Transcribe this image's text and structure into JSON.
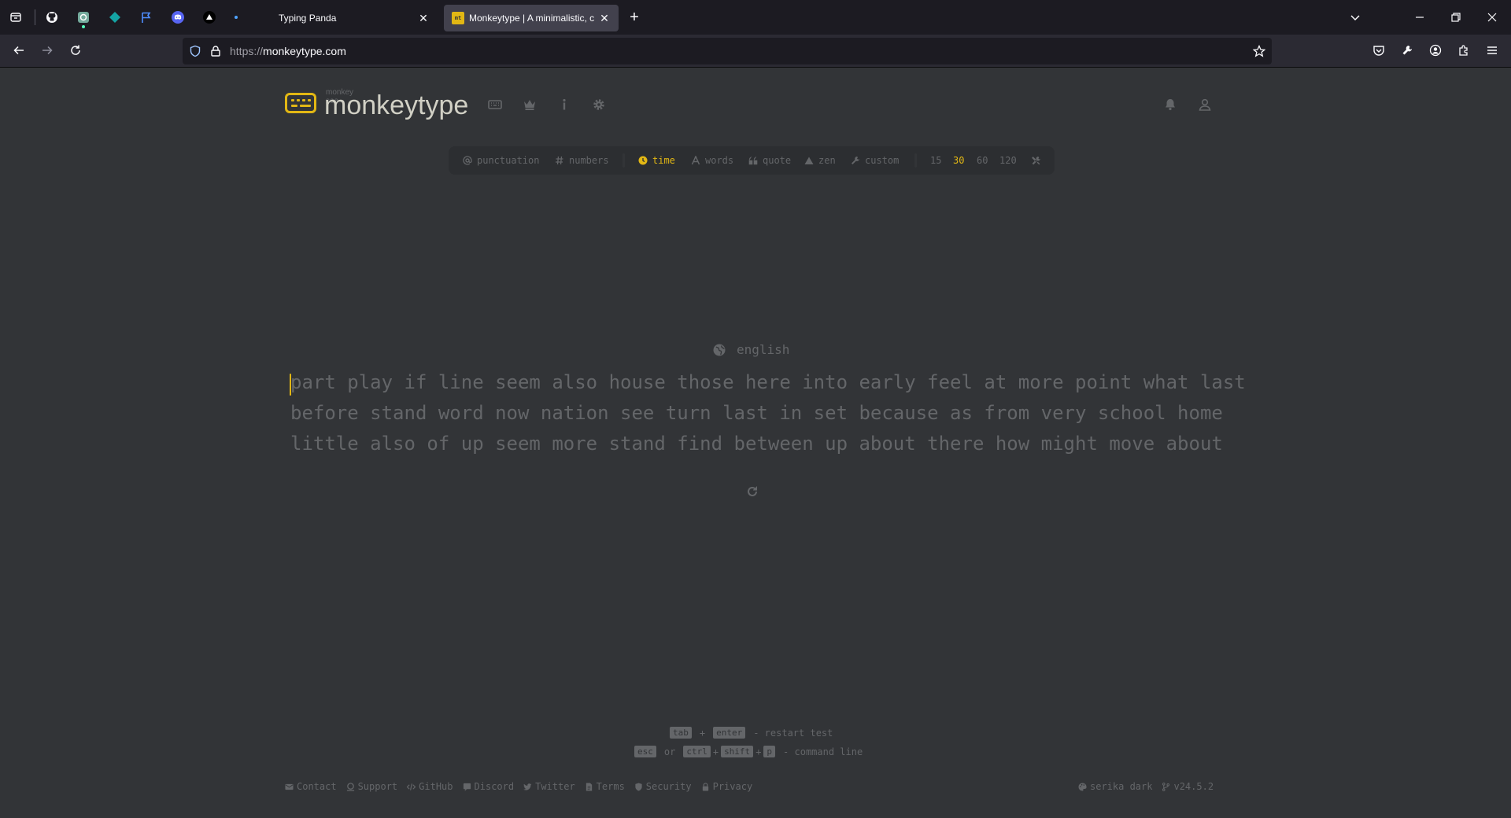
{
  "browser": {
    "tabs": [
      {
        "title": "Typing Panda",
        "active": false
      },
      {
        "title": "Monkeytype | A minimalistic, c",
        "active": true,
        "favicon": "mt"
      }
    ],
    "new_tab_label": "+",
    "url_scheme": "https://",
    "url_host": "monkeytype.com"
  },
  "logo": {
    "top_text": "monkey see",
    "main_text": "monkeytype"
  },
  "config": {
    "punctuation": "punctuation",
    "numbers": "numbers",
    "time": "time",
    "words": "words",
    "quote": "quote",
    "zen": "zen",
    "custom": "custom",
    "durations": [
      "15",
      "30",
      "60",
      "120"
    ],
    "selected_duration": "30",
    "selected_mode": "time"
  },
  "test": {
    "language": "english",
    "lines": [
      "part play if line seem also house those here into early feel at more point what last",
      "before stand word now nation see turn last in set because as from very school home",
      "little also of up seem more stand find between up about there how might move about"
    ]
  },
  "hints": {
    "tab": "tab",
    "plus": "+",
    "enter": "enter",
    "restart_text": "- restart test",
    "esc": "esc",
    "or": "or",
    "ctrl": "ctrl",
    "shift": "shift",
    "p": "p",
    "command_text": "- command line"
  },
  "footer": {
    "contact": "Contact",
    "support": "Support",
    "github": "GitHub",
    "discord": "Discord",
    "twitter": "Twitter",
    "terms": "Terms",
    "security": "Security",
    "privacy": "Privacy",
    "theme": "serika dark",
    "version": "v24.5.2"
  },
  "colors": {
    "bg": "#323437",
    "sub_alt": "#2c2e31",
    "main": "#e2b714",
    "sub": "#646669",
    "text": "#d1d0c5"
  }
}
